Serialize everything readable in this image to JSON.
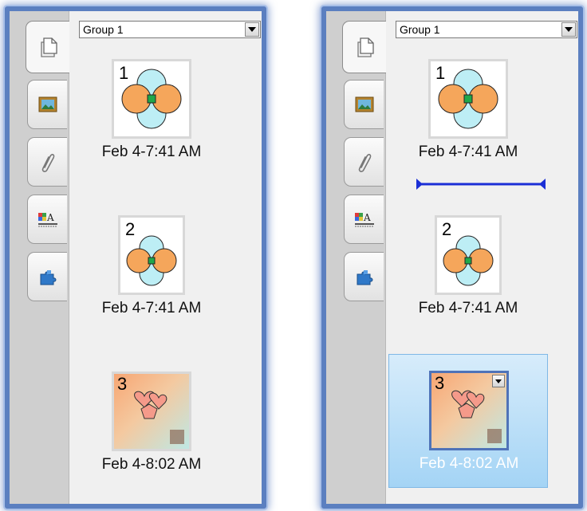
{
  "left_panel": {
    "group": "Group 1",
    "tabs": [
      "page-sorter",
      "gallery",
      "attachments",
      "properties",
      "add-ons"
    ],
    "pages": [
      {
        "number": "1",
        "caption": "Feb 4-7:41 AM"
      },
      {
        "number": "2",
        "caption": "Feb 4-7:41 AM"
      },
      {
        "number": "3",
        "caption": "Feb 4-8:02 AM"
      }
    ]
  },
  "right_panel": {
    "group": "Group 1",
    "tabs": [
      "page-sorter",
      "gallery",
      "attachments",
      "properties",
      "add-ons"
    ],
    "pages": [
      {
        "number": "1",
        "caption": "Feb 4-7:41 AM"
      },
      {
        "number": "2",
        "caption": "Feb 4-7:41 AM"
      },
      {
        "number": "3",
        "caption": "Feb 4-8:02 AM",
        "selected": true
      }
    ]
  },
  "colors": {
    "panel_border": "#5b7fc0",
    "circle_orange": "#f5a65b",
    "circle_blue": "#bdeef5",
    "center_green": "#1fa84a",
    "selection": "#a4d4f5",
    "insert_marker": "#1b2fd6"
  }
}
